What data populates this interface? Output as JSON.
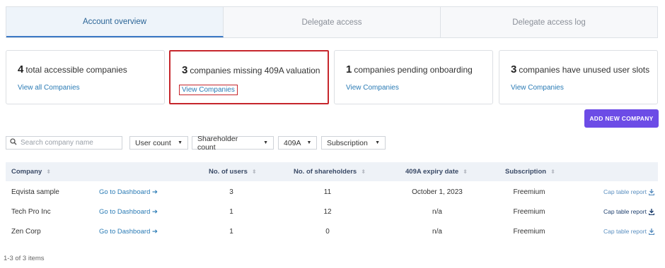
{
  "tabs": [
    {
      "label": "Account overview",
      "active": true
    },
    {
      "label": "Delegate access",
      "active": false
    },
    {
      "label": "Delegate access log",
      "active": false
    }
  ],
  "cards": [
    {
      "count": "4",
      "text": "total accessible companies",
      "link": "View all Companies",
      "highlighted": false
    },
    {
      "count": "3",
      "text": "companies missing 409A valuation",
      "link": "View Companies",
      "highlighted": true
    },
    {
      "count": "1",
      "text": "companies pending onboarding",
      "link": "View Companies",
      "highlighted": false
    },
    {
      "count": "3",
      "text": "companies have unused user slots",
      "link": "View Companies",
      "highlighted": false
    }
  ],
  "add_button": "ADD NEW COMPANY",
  "filters": {
    "search_placeholder": "Search company name",
    "user_count": "User count",
    "shareholder_count": "Shareholder count",
    "valuation": "409A",
    "subscription": "Subscription"
  },
  "table": {
    "headers": {
      "company": "Company",
      "users": "No. of users",
      "shareholders": "No. of shareholders",
      "expiry": "409A expiry date",
      "subscription": "Subscription"
    },
    "rows": [
      {
        "company": "Eqvista sample",
        "dashboard": "Go to Dashboard",
        "users": "3",
        "shareholders": "11",
        "expiry": "October 1, 2023",
        "subscription": "Freemium",
        "report": "Cap table report"
      },
      {
        "company": "Tech Pro Inc",
        "dashboard": "Go to Dashboard",
        "users": "1",
        "shareholders": "12",
        "expiry": "n/a",
        "subscription": "Freemium",
        "report": "Cap table report"
      },
      {
        "company": "Zen Corp",
        "dashboard": "Go to Dashboard",
        "users": "1",
        "shareholders": "0",
        "expiry": "n/a",
        "subscription": "Freemium",
        "report": "Cap table report"
      }
    ]
  },
  "pagination": "1-3 of 3 items",
  "colors": {
    "accent": "#3b78c4",
    "link": "#2a7bb5",
    "button": "#6c4ce6",
    "highlight": "#c6262c"
  }
}
